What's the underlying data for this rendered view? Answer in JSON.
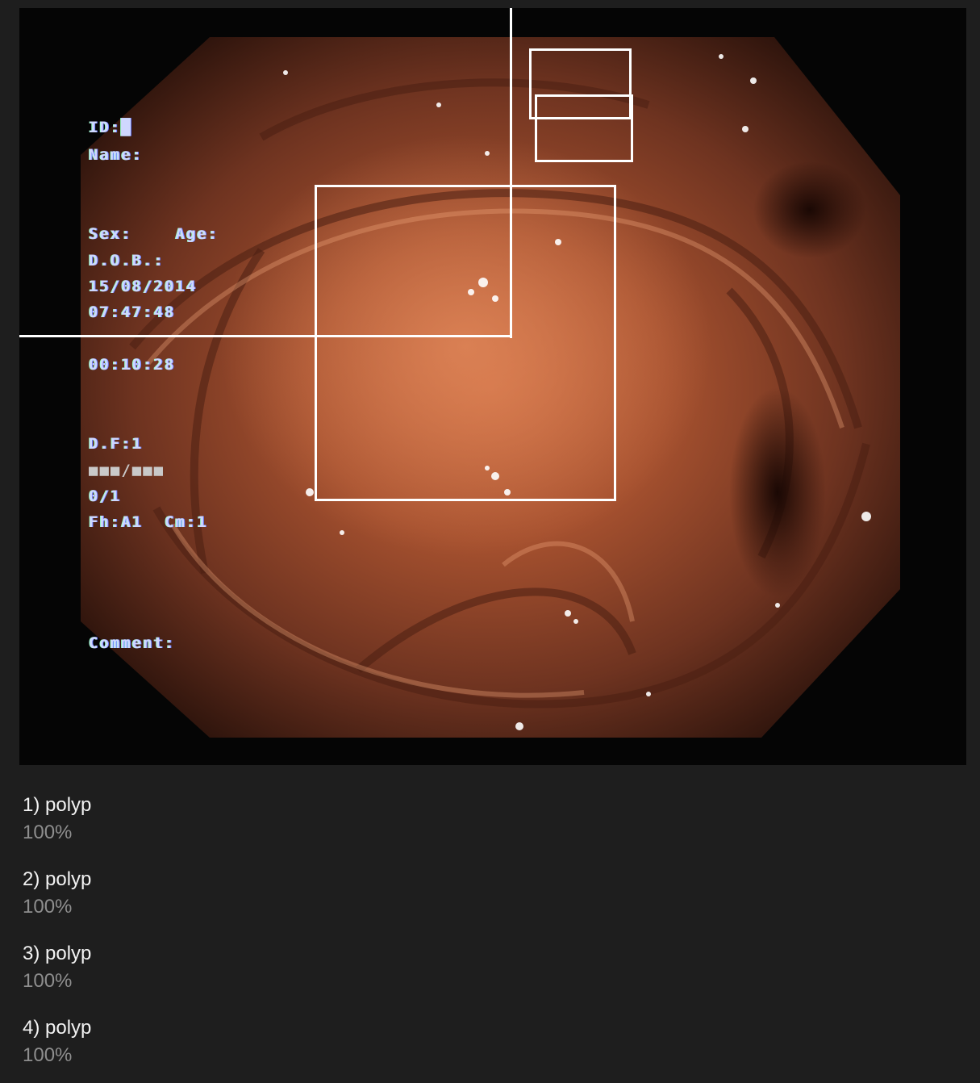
{
  "overlay": {
    "id": "ID:█",
    "name": "Name:",
    "sex_age": "Sex:    Age:",
    "dob": "D.O.B.:",
    "date": "15/08/2014",
    "time": "07:47:48",
    "elapsed": "00:10:28",
    "df": "D.F:1",
    "blocks": "■■■/■■■",
    "ratio": "0/1",
    "fh_cm": "Fh:A1  Cm:1",
    "comment": "Comment:"
  },
  "detections": [
    {
      "label": "1) polyp",
      "score": "100%"
    },
    {
      "label": "2) polyp",
      "score": "100%"
    },
    {
      "label": "3) polyp",
      "score": "100%"
    },
    {
      "label": "4) polyp",
      "score": "100%"
    }
  ],
  "colors": {
    "page_background": "#1e1e1e",
    "box_stroke": "#ffffff",
    "label_text": "#f2f2f2",
    "score_text": "#8e8e8e"
  }
}
